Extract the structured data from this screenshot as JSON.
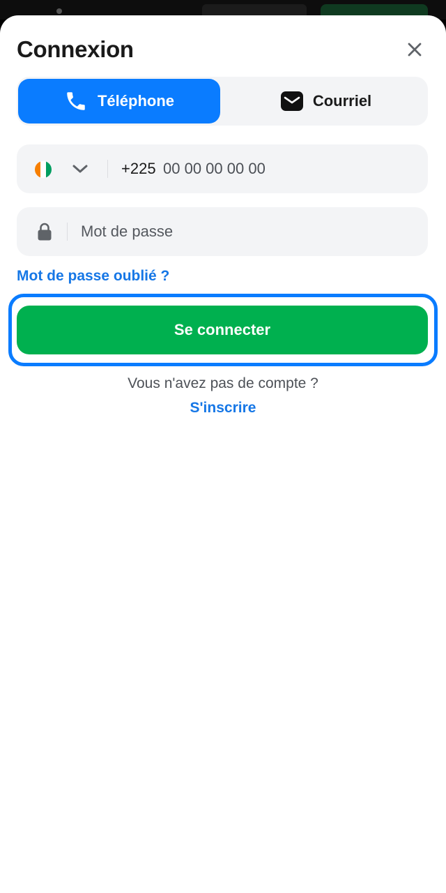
{
  "modal": {
    "title": "Connexion",
    "close_icon": "close-icon"
  },
  "tabs": [
    {
      "label": "Téléphone",
      "icon": "phone-icon",
      "active": true
    },
    {
      "label": "Courriel",
      "icon": "mail-icon",
      "active": false
    }
  ],
  "phone": {
    "country_flag": "ivory-coast-flag-icon",
    "dropdown_icon": "chevron-down-icon",
    "prefix": "+225",
    "placeholder": "00 00 00 00 00"
  },
  "password": {
    "icon": "lock-icon",
    "placeholder": "Mot de passe"
  },
  "forgot_link": "Mot de passe oublié ?",
  "submit_label": "Se connecter",
  "no_account_text": "Vous n'avez pas de compte ?",
  "signup_link": "S'inscrire",
  "colors": {
    "accent_blue": "#0a7cff",
    "link_blue": "#1677e6",
    "submit_green": "#00b04f",
    "field_bg": "#f3f4f6"
  }
}
